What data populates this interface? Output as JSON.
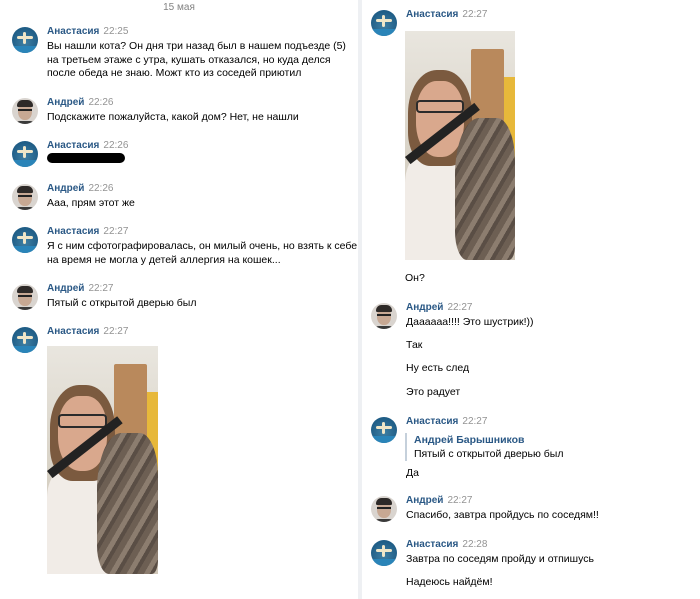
{
  "date_separator": "15 мая",
  "users": {
    "anastasia": "Анастасия",
    "andrey": "Андрей"
  },
  "left": {
    "m1": {
      "time": "22:25",
      "text": "Вы нашли кота? Он дня три назад был в нашем подъезде (5)\nна третьем этаже с утра, кушать отказался, но куда делся\nпосле обеда не знаю. Можт кто из соседей приютил"
    },
    "m2": {
      "time": "22:26",
      "text": "Подскажите пожалуйста, какой дом? Нет, не нашли"
    },
    "m3": {
      "time": "22:26"
    },
    "m4": {
      "time": "22:26",
      "text": "Ааа, прям этот же"
    },
    "m5": {
      "time": "22:27",
      "text": "Я с ним сфотографировалась, он милый очень, но взять к себе\nна время не могла у детей аллергия на кошек..."
    },
    "m6": {
      "time": "22:27",
      "text": "Пятый с открытой дверью был"
    },
    "m7": {
      "time": "22:27"
    }
  },
  "right": {
    "r1": {
      "time": "22:27",
      "text": "Он?"
    },
    "r2": {
      "time": "22:27",
      "lines": [
        "Даааааа!!!! Это шустрик!))",
        "Так",
        "Ну есть след",
        "Это радует"
      ]
    },
    "r3": {
      "time": "22:27",
      "quote_name": "Андрей Барышников",
      "quote_text": "Пятый с открытой дверью был",
      "text": "Да"
    },
    "r4": {
      "time": "22:27",
      "text": "Спасибо, завтра пройдусь по соседям!!"
    },
    "r5": {
      "time": "22:28",
      "lines": [
        "Завтра по соседям пройду и отпишусь",
        "Надеюсь найдём!"
      ]
    }
  },
  "colors": {
    "name": "#2a5885",
    "time": "#939393",
    "background": "#ffffff"
  }
}
